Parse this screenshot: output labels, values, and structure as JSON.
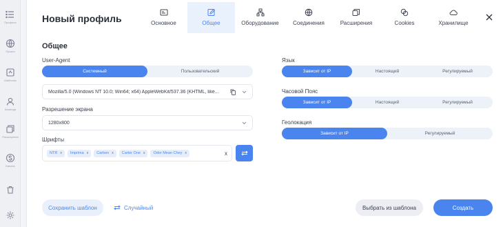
{
  "sidebar": {
    "items": [
      {
        "label": "Профили",
        "icon": "list-icon"
      },
      {
        "label": "Прокси",
        "icon": "globe-icon"
      },
      {
        "label": "Шаблоны",
        "icon": "template-icon"
      },
      {
        "label": "Команда",
        "icon": "team-icon"
      },
      {
        "label": "Расширения",
        "icon": "extensions-icon"
      },
      {
        "label": "Баланс",
        "icon": "dollar-icon"
      },
      {
        "label": "",
        "icon": "trash-icon"
      },
      {
        "label": "",
        "icon": "settings-icon"
      }
    ]
  },
  "header": {
    "title": "Новый профиль",
    "tabs": [
      {
        "label": "Основное",
        "icon": "id-card-icon"
      },
      {
        "label": "Общее",
        "icon": "edit-icon",
        "active": true
      },
      {
        "label": "Оборудование",
        "icon": "hardware-icon"
      },
      {
        "label": "Соединения",
        "icon": "globe-icon"
      },
      {
        "label": "Расширения",
        "icon": "extensions-icon"
      },
      {
        "label": "Cookies",
        "icon": "cookie-icon"
      },
      {
        "label": "Хранилище",
        "icon": "cloud-icon"
      }
    ],
    "close_icon": "close-icon"
  },
  "section_title": "Общее",
  "user_agent": {
    "label": "User-Agent",
    "options": [
      "Системный",
      "Пользовательский"
    ],
    "selected": "Системный",
    "value": "Mozilla/5.0 (Windows NT 10.0; Win64; x64) AppleWebKit/537.36 (KHTML, like..."
  },
  "resolution": {
    "label": "Разрешение экрана",
    "value": "1280x800"
  },
  "fonts": {
    "label": "Шрифты",
    "chips": [
      "NTR",
      "Imprima",
      "Carben",
      "Carter One",
      "Odor Mean Chey"
    ],
    "chip_close": "x",
    "clear": "x"
  },
  "language": {
    "label": "Язык",
    "options": [
      "Зависит от IP",
      "Настоящий",
      "Регулируемый"
    ],
    "selected": "Зависит от IP"
  },
  "timezone": {
    "label": "Часовой Пояс",
    "options": [
      "Зависит от IP",
      "Настоящий",
      "Регулируемый"
    ],
    "selected": "Зависит от IP"
  },
  "geolocation": {
    "label": "Геолокация",
    "options": [
      "Зависит от IP",
      "Регулируемый"
    ],
    "selected": "Зависит от IP"
  },
  "footer": {
    "save_template": "Сохранить шаблон",
    "random": "Случайный",
    "choose_template": "Выбрать из шаблона",
    "create": "Создать"
  },
  "colors": {
    "accent": "#4a84ef",
    "accent_light": "#e9f1fd",
    "background": "#f3f4f7"
  }
}
